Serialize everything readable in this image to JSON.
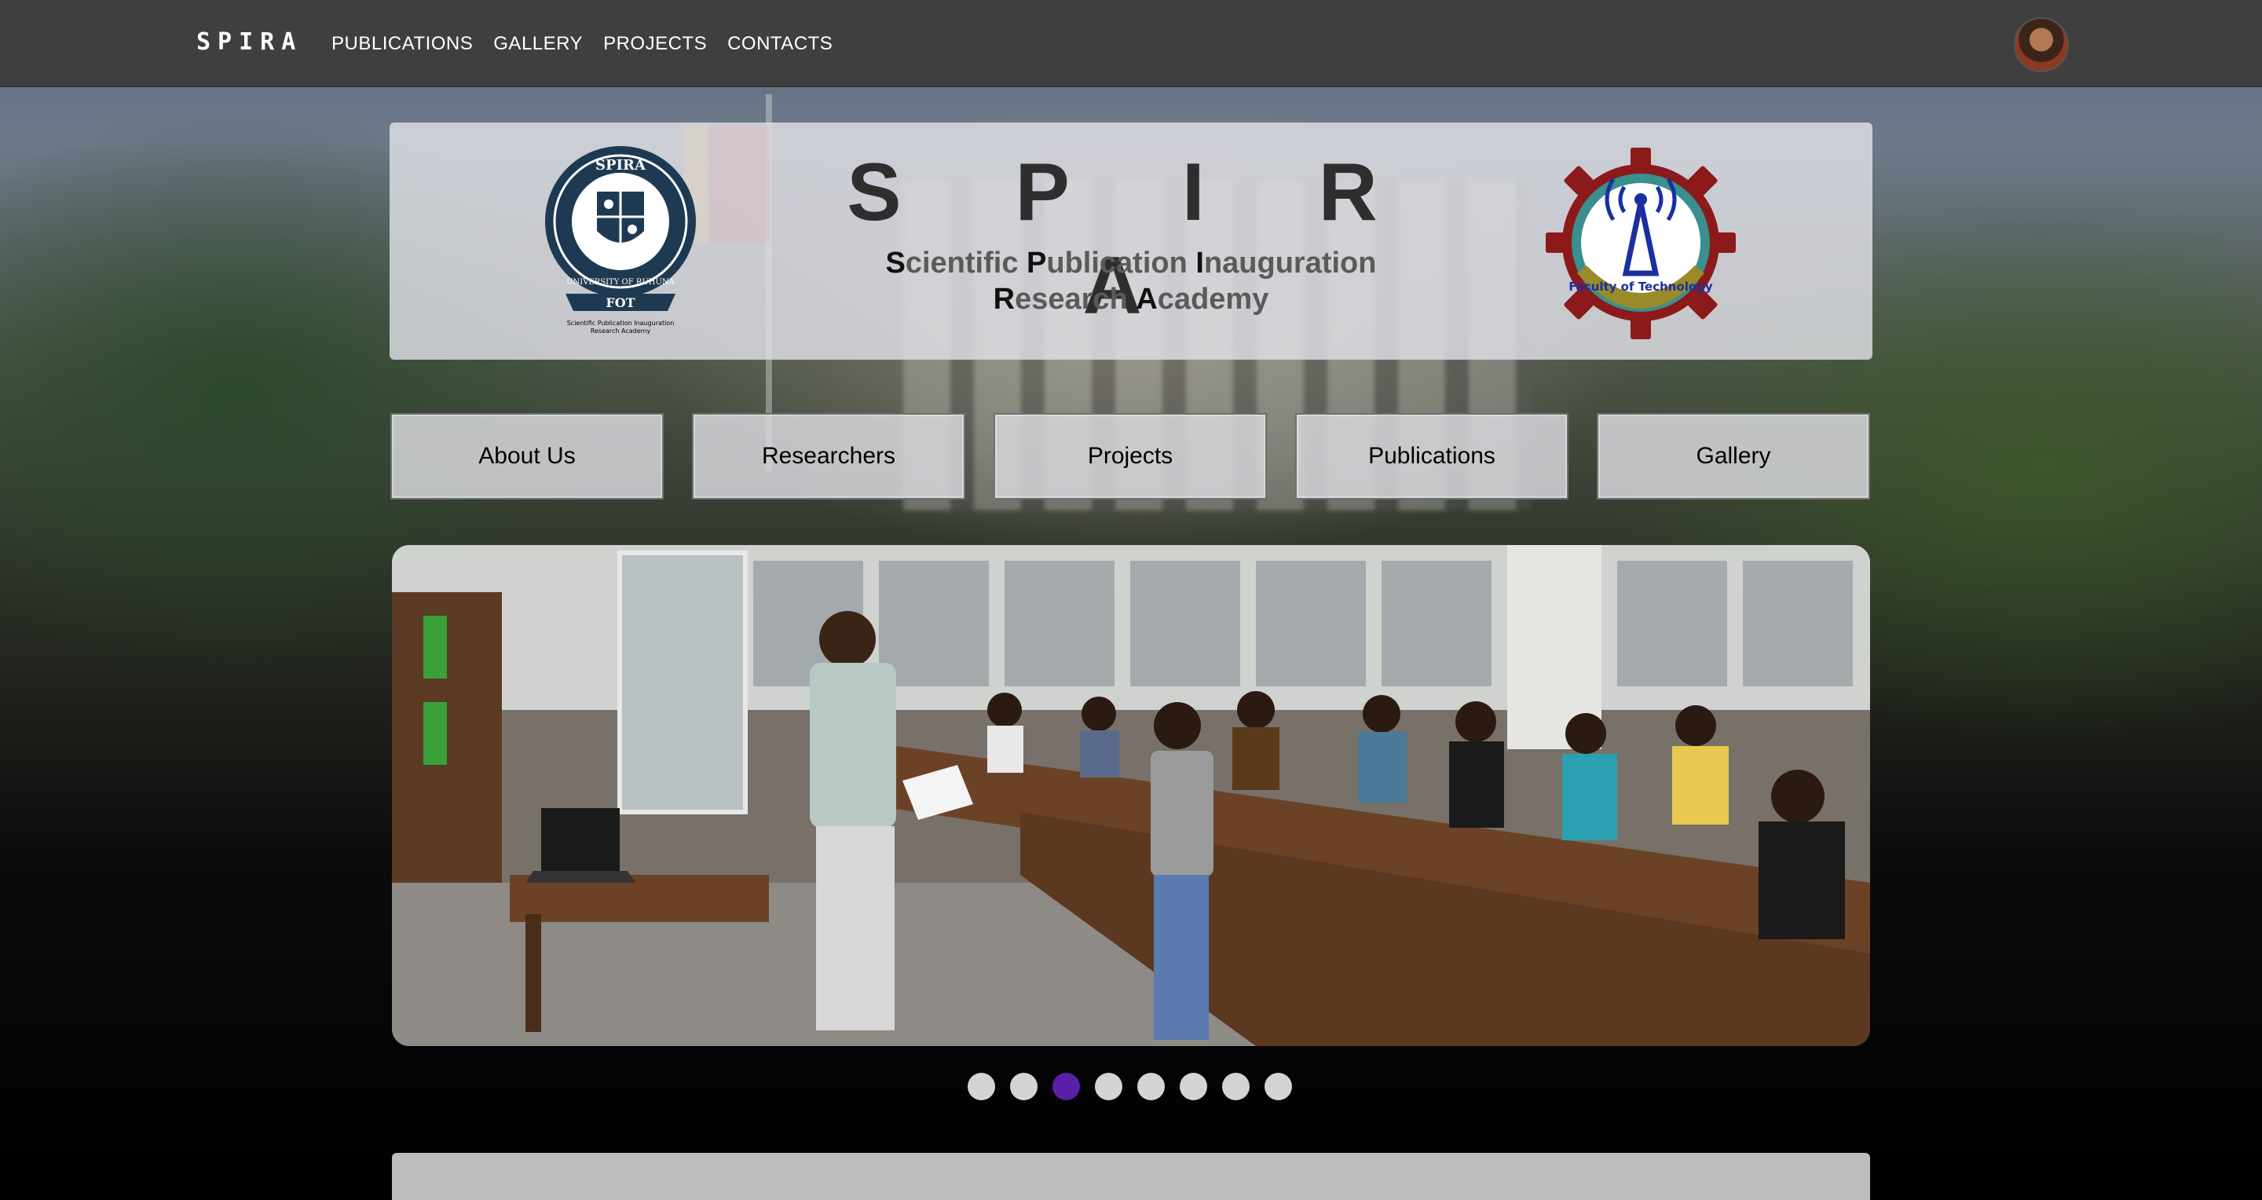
{
  "nav": {
    "brand": "SPIRA",
    "links": [
      "PUBLICATIONS",
      "GALLERY",
      "PROJECTS",
      "CONTACTS"
    ]
  },
  "header": {
    "title": "S P I R A",
    "subtitle": {
      "line1": [
        {
          "initial": "S",
          "rest": "cientific "
        },
        {
          "initial": "P",
          "rest": "ublication "
        },
        {
          "initial": "I",
          "rest": "nauguration"
        }
      ],
      "line2": [
        {
          "initial": "R",
          "rest": "esearch "
        },
        {
          "initial": "A",
          "rest": "cademy"
        }
      ]
    },
    "left_logo": {
      "top_text": "SPIRA",
      "ring_text": "UNIVERSITY OF RUHUNA",
      "ribbon_text": "FOT",
      "caption_line1": "Scientific Publication Inauguration",
      "caption_line2": "Research Academy"
    },
    "right_logo": {
      "text": "Faculty of Technology"
    }
  },
  "sections": [
    "About Us",
    "Researchers",
    "Projects",
    "Publications",
    "Gallery"
  ],
  "carousel": {
    "slide_count": 8,
    "active_index": 2
  },
  "colors": {
    "nav_bg": "#3f3f3f",
    "active_dot": "#5a1fa8",
    "inactive_dot": "#d4d4d4",
    "logo_navy": "#1e3a52",
    "logo_maroon": "#8c1a1a",
    "logo_teal": "#3a8f8f",
    "logo_blue": "#1a2fa0"
  }
}
